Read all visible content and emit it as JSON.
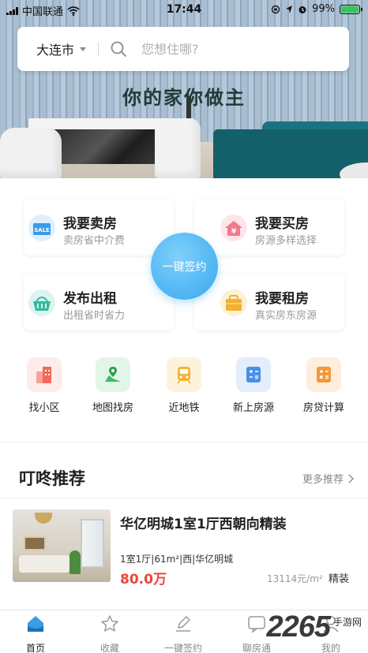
{
  "status_bar": {
    "carrier": "中国联通",
    "time": "17:44",
    "battery_percent": "99%",
    "battery_level": 0.99
  },
  "hero": {
    "slogan": "你的家你做主"
  },
  "search": {
    "city": "大连市",
    "placeholder": "您想住哪?"
  },
  "main_services": [
    {
      "title": "我要卖房",
      "subtitle": "卖房省中介费",
      "icon": "sale-tag-icon",
      "color": "#3a9be6"
    },
    {
      "title": "我要买房",
      "subtitle": "房源多样选择",
      "icon": "house-yuan-icon",
      "color": "#f07a8a"
    },
    {
      "title": "发布出租",
      "subtitle": "出租省时省力",
      "icon": "basket-icon",
      "color": "#34b9a2"
    },
    {
      "title": "我要租房",
      "subtitle": "真实房东房源",
      "icon": "briefcase-icon",
      "color": "#f2b12e"
    }
  ],
  "sign_button": "一键签约",
  "quick_entries": [
    {
      "label": "找小区",
      "icon": "community-building-icon",
      "color": "#f16a5a"
    },
    {
      "label": "地图找房",
      "icon": "map-icon",
      "color": "#3dbb6a"
    },
    {
      "label": "近地铁",
      "icon": "subway-icon",
      "color": "#f4b43b"
    },
    {
      "label": "新上房源",
      "icon": "calculator-icon",
      "color": "#4a8fe8"
    },
    {
      "label": "房贷计算",
      "icon": "loan-calculator-icon",
      "color": "#f3973a"
    }
  ],
  "recommend": {
    "title": "叮咚推荐",
    "more": "更多推荐"
  },
  "listing": {
    "title": "华亿明城1室1厅西朝向精装",
    "meta": "1室1厅|61m²|西|华亿明城",
    "price": "80.0万",
    "unit_price": "13114元/m²",
    "tag": "精装"
  },
  "tabs": [
    {
      "label": "首页",
      "icon": "home-icon",
      "active": true
    },
    {
      "label": "收藏",
      "icon": "star-icon",
      "active": false
    },
    {
      "label": "一键签约",
      "icon": "sign-pen-icon",
      "active": false
    },
    {
      "label": "聊房通",
      "icon": "chat-icon",
      "active": false
    },
    {
      "label": "我的",
      "icon": "user-icon",
      "active": false
    }
  ],
  "watermark": {
    "number": "2265",
    "site": "手游网"
  }
}
